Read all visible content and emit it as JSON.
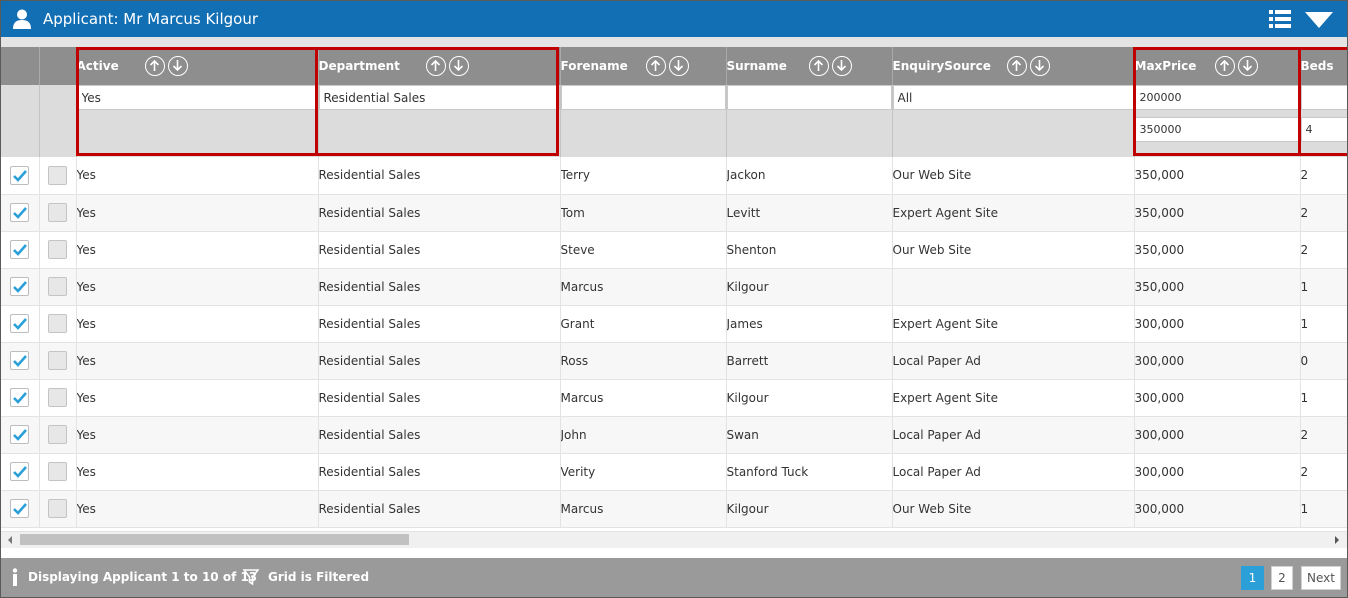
{
  "header": {
    "title": "Applicant: Mr Marcus Kilgour",
    "icons": [
      "user-icon",
      "list-view-icon",
      "dropdown-triangle-icon"
    ]
  },
  "columns": [
    {
      "key": "active",
      "label": "Active"
    },
    {
      "key": "department",
      "label": "Department"
    },
    {
      "key": "forename",
      "label": "Forename"
    },
    {
      "key": "surname",
      "label": "Surname"
    },
    {
      "key": "enquiry_source",
      "label": "EnquirySource"
    },
    {
      "key": "max_price",
      "label": "MaxPrice"
    },
    {
      "key": "beds",
      "label": "Beds"
    }
  ],
  "filters": {
    "active": "Yes",
    "department": "Residential Sales",
    "forename": "",
    "surname": "",
    "enquiry_source": "All",
    "max_price_from": "200000",
    "max_price_to": "350000",
    "beds_from": "",
    "beds_to": "4"
  },
  "rows": [
    {
      "checked": true,
      "active": "Yes",
      "department": "Residential Sales",
      "forename": "Terry",
      "surname": "Jackon",
      "enquiry_source": "Our Web Site",
      "max_price": "350,000",
      "beds": "2"
    },
    {
      "checked": true,
      "active": "Yes",
      "department": "Residential Sales",
      "forename": "Tom",
      "surname": "Levitt",
      "enquiry_source": "Expert Agent Site",
      "max_price": "350,000",
      "beds": "2"
    },
    {
      "checked": true,
      "active": "Yes",
      "department": "Residential Sales",
      "forename": "Steve",
      "surname": "Shenton",
      "enquiry_source": "Our Web Site",
      "max_price": "350,000",
      "beds": "2"
    },
    {
      "checked": true,
      "active": "Yes",
      "department": "Residential Sales",
      "forename": "Marcus",
      "surname": "Kilgour",
      "enquiry_source": "",
      "max_price": "350,000",
      "beds": "1"
    },
    {
      "checked": true,
      "active": "Yes",
      "department": "Residential Sales",
      "forename": "Grant",
      "surname": "James",
      "enquiry_source": "Expert Agent Site",
      "max_price": "300,000",
      "beds": "1"
    },
    {
      "checked": true,
      "active": "Yes",
      "department": "Residential Sales",
      "forename": "Ross",
      "surname": "Barrett",
      "enquiry_source": "Local Paper Ad",
      "max_price": "300,000",
      "beds": "0"
    },
    {
      "checked": true,
      "active": "Yes",
      "department": "Residential Sales",
      "forename": "Marcus",
      "surname": "Kilgour",
      "enquiry_source": "Expert Agent Site",
      "max_price": "300,000",
      "beds": "1"
    },
    {
      "checked": true,
      "active": "Yes",
      "department": "Residential Sales",
      "forename": "John",
      "surname": "Swan",
      "enquiry_source": "Local Paper Ad",
      "max_price": "300,000",
      "beds": "2"
    },
    {
      "checked": true,
      "active": "Yes",
      "department": "Residential Sales",
      "forename": "Verity",
      "surname": "Stanford Tuck",
      "enquiry_source": "Local Paper Ad",
      "max_price": "300,000",
      "beds": "2"
    },
    {
      "checked": true,
      "active": "Yes",
      "department": "Residential Sales",
      "forename": "Marcus",
      "surname": "Kilgour",
      "enquiry_source": "Our Web Site",
      "max_price": "300,000",
      "beds": "1"
    }
  ],
  "footer": {
    "status": "Displaying Applicant 1 to 10 of 13",
    "filter_status": "Grid is Filtered",
    "pager": {
      "pages": [
        "1",
        "2"
      ],
      "current": "1",
      "next_label": "Next"
    }
  },
  "colors": {
    "title_bar": "#136fb3",
    "header_row": "#8e8e8e",
    "filter_row": "#dcdcdc",
    "highlight": "#c00000",
    "check": "#2a9fd8",
    "footer": "#9a9a9a"
  }
}
